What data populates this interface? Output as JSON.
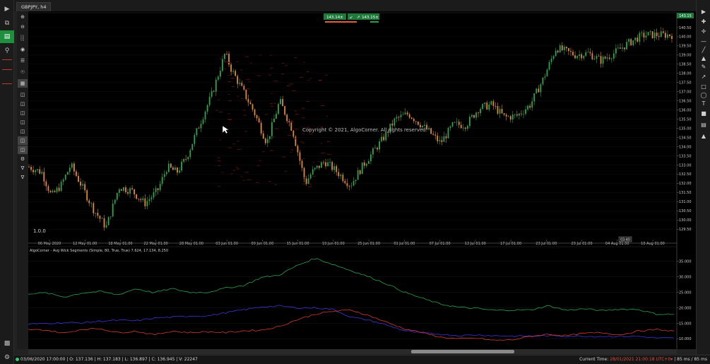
{
  "tab": {
    "title": "GBPJPY, h4"
  },
  "quote": {
    "bid": "143.14±",
    "ask": "143.15±",
    "sell_icon": "arrow-down-icon",
    "buy_icon": "arrow-up-icon"
  },
  "watermark": "Copyright © 2021, AlgoCorner. All rights reserved.",
  "version_label": "1.0.0",
  "price_badge": "143.15",
  "cross_badge": "03:40",
  "indicator": {
    "label": "AlgoCorner - Avg Wick Segments (Simple, 80, True, True) 7.624, 17.134, 8.250",
    "colors": {
      "upper": "#2aa148",
      "middle": "#3a35d8",
      "lower": "#d23a2a"
    }
  },
  "status": {
    "ohlc": "03/06/2020 17:00:00 | O: 137.136 | H: 137.183 | L: 136.897 | C: 136.945 | V: 22247",
    "current_time_label": "Current Time:",
    "current_time": "28/01/2021 21:00:18",
    "timezone": "UTC+0",
    "latency": "| 85 ms / 85 ms"
  },
  "chart_data": [
    {
      "type": "candlestick",
      "symbol": "GBPJPY",
      "timeframe": "h4",
      "ylim": [
        129.2,
        141.0
      ],
      "y_ticks": [
        "140.50",
        "140.00",
        "139.50",
        "139.00",
        "138.50",
        "138.00",
        "137.50",
        "137.00",
        "136.50",
        "136.00",
        "135.50",
        "135.00",
        "134.50",
        "134.00",
        "133.50",
        "133.00",
        "132.50",
        "132.00",
        "131.50",
        "131.00",
        "130.50",
        "130.00",
        "129.50"
      ],
      "x_ticks": [
        "06 May 2020",
        "12 May 01:00",
        "18 May 01:00",
        "22 May 01:00",
        "28 May 01:00",
        "03 Jun 01:00",
        "09 Jun 01:00",
        "15 Jun 01:00",
        "19 Jun 01:00",
        "25 Jun 01:00",
        "01 Jul 01:00",
        "07 Jul 01:00",
        "13 Jul 01:00",
        "17 Jul 01:00",
        "23 Jul 01:00",
        "29 Jul 01:00",
        "04 Aug 01:00",
        "10 Aug 01:00"
      ],
      "price_path": [
        [
          0,
          132.9
        ],
        [
          0.02,
          132.6
        ],
        [
          0.035,
          131.3
        ],
        [
          0.05,
          131.9
        ],
        [
          0.065,
          133.0
        ],
        [
          0.08,
          132.0
        ],
        [
          0.1,
          130.6
        ],
        [
          0.12,
          129.6
        ],
        [
          0.14,
          131.8
        ],
        [
          0.16,
          131.6
        ],
        [
          0.18,
          130.9
        ],
        [
          0.2,
          131.6
        ],
        [
          0.215,
          132.9
        ],
        [
          0.23,
          132.6
        ],
        [
          0.245,
          133.4
        ],
        [
          0.265,
          135.2
        ],
        [
          0.285,
          136.9
        ],
        [
          0.305,
          139.1
        ],
        [
          0.315,
          138.2
        ],
        [
          0.335,
          136.9
        ],
        [
          0.35,
          135.9
        ],
        [
          0.37,
          134.2
        ],
        [
          0.39,
          136.5
        ],
        [
          0.41,
          134.9
        ],
        [
          0.43,
          132.0
        ],
        [
          0.44,
          132.6
        ],
        [
          0.46,
          133.2
        ],
        [
          0.48,
          132.6
        ],
        [
          0.5,
          131.9
        ],
        [
          0.52,
          133.0
        ],
        [
          0.55,
          134.4
        ],
        [
          0.57,
          135.5
        ],
        [
          0.59,
          135.8
        ],
        [
          0.62,
          134.9
        ],
        [
          0.64,
          134.2
        ],
        [
          0.66,
          135.2
        ],
        [
          0.68,
          135.2
        ],
        [
          0.7,
          136.1
        ],
        [
          0.72,
          136.3
        ],
        [
          0.74,
          135.6
        ],
        [
          0.76,
          135.7
        ],
        [
          0.78,
          136.3
        ],
        [
          0.8,
          137.7
        ],
        [
          0.82,
          139.4
        ],
        [
          0.85,
          139.0
        ],
        [
          0.87,
          139.1
        ],
        [
          0.89,
          138.7
        ],
        [
          0.91,
          139.1
        ],
        [
          0.93,
          139.6
        ],
        [
          0.95,
          140.0
        ],
        [
          0.96,
          140.1
        ]
      ]
    },
    {
      "type": "line",
      "title": "AlgoCorner - Avg Wick Segments (Simple, 80, True, True)",
      "ylim": [
        8.5,
        37.0
      ],
      "y_ticks": [
        "35.000",
        "30.000",
        "25.000",
        "20.000",
        "15.000",
        "10.000"
      ],
      "series": [
        {
          "values": [
            24.6,
            24.8,
            23.5,
            24.8,
            25.3,
            24.2,
            26.2,
            24.9,
            26.2,
            25.0,
            25.0,
            26.4,
            27.2,
            29.8,
            30.6,
            33.7,
            36.0,
            34.0,
            32.0,
            30.0,
            27.7,
            25.0,
            23.0,
            21.2,
            20.2,
            19.8,
            19.2,
            19.3,
            19.3,
            20.7,
            19.2,
            19.7,
            19.1,
            19.6,
            19.5,
            18.0,
            17.9
          ]
        },
        {
          "values": [
            14.7,
            15.0,
            15.2,
            15.2,
            15.7,
            16.0,
            15.8,
            16.7,
            17.0,
            17.4,
            17.4,
            18.4,
            19.4,
            20.3,
            20.6,
            20.0,
            20.0,
            19.5,
            17.0,
            16.0,
            14.4,
            12.6,
            11.8,
            11.5,
            11.0,
            11.3,
            11.0,
            10.9,
            10.9,
            11.0,
            10.9,
            10.8,
            10.8,
            10.8,
            10.8,
            10.3,
            10.2
          ]
        },
        {
          "values": [
            13.0,
            12.8,
            11.8,
            13.1,
            13.3,
            12.0,
            12.5,
            11.3,
            12.5,
            12.0,
            12.3,
            12.0,
            12.6,
            12.8,
            14.0,
            16.2,
            18.0,
            18.9,
            19.3,
            17.5,
            15.3,
            13.2,
            12.0,
            10.5,
            10.0,
            10.2,
            9.5,
            9.7,
            10.8,
            11.5,
            11.0,
            11.8,
            12.0,
            11.3,
            12.5,
            13.0,
            12.5
          ]
        }
      ]
    }
  ]
}
